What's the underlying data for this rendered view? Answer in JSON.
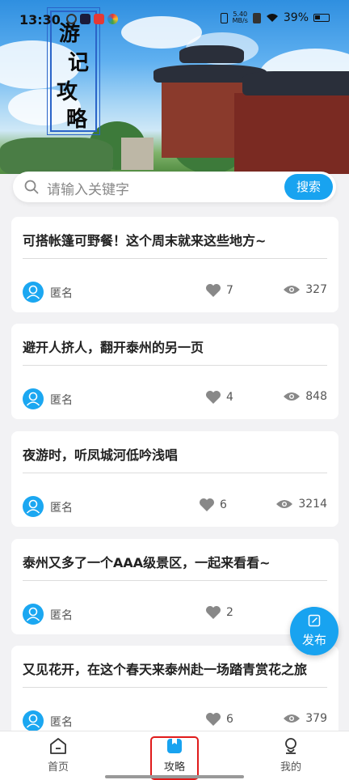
{
  "status_bar": {
    "time": "13:30",
    "net_speed_value": "5.40",
    "net_speed_unit": "MB/s",
    "battery": "39%"
  },
  "banner": {
    "title_chars": [
      "游",
      "记",
      "攻",
      "略"
    ]
  },
  "search": {
    "placeholder": "请输入关键字",
    "button": "搜索"
  },
  "posts": [
    {
      "title": "可搭帐篷可野餐！这个周末就来这些地方~",
      "author": "匿名",
      "likes": "7",
      "views": "327"
    },
    {
      "title": "避开人挤人，翻开泰州的另一页",
      "author": "匿名",
      "likes": "4",
      "views": "848"
    },
    {
      "title": "夜游时，听凤城河低吟浅唱",
      "author": "匿名",
      "likes": "6",
      "views": "3214"
    },
    {
      "title": "泰州又多了一个AAA级景区，一起来看看~",
      "author": "匿名",
      "likes": "2",
      "views": ""
    },
    {
      "title": "又见花开，在这个春天来泰州赴一场踏青赏花之旅",
      "author": "匿名",
      "likes": "6",
      "views": "379"
    }
  ],
  "fab": {
    "label": "发布"
  },
  "nav": {
    "home": "首页",
    "guide": "攻略",
    "mine": "我的"
  },
  "colors": {
    "accent": "#18a3f0",
    "active_highlight": "#e01b1b"
  }
}
